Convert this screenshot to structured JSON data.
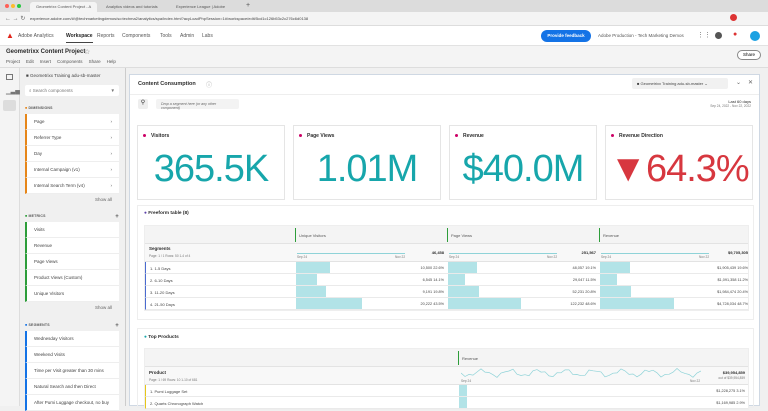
{
  "browser": {
    "tabs": [
      "Geometrixx Content Project - A",
      "Analytics videos and tutorials",
      "Experience League | Adobe"
    ],
    "url": "experience.adobe.com/#/@techmarketingdemos/so:techma2/analytics/spa/index.html?acyLoadPhpSession=1#/workspace/edit/5cd1c126b53c2c276c6d0138"
  },
  "app": {
    "name": "Adobe Analytics",
    "nav": [
      "Workspace",
      "Reports",
      "Components",
      "Tools",
      "Admin",
      "Labs"
    ],
    "feedback": "Provide feedback",
    "org": "Adobe Production - Tech Marketing Demos"
  },
  "project": {
    "title": "Geometrixx Content Project",
    "menu": [
      "Project",
      "Edit",
      "Insert",
      "Components",
      "Share",
      "Help"
    ],
    "share": "Share"
  },
  "panel": {
    "report_suite": "Geometrixx Training adu-sb-master",
    "search_placeholder": "Search components",
    "dimensions": {
      "label": "DIMENSIONS",
      "items": [
        "Page",
        "Referrer Type",
        "Day",
        "Internal Campaign (v1)",
        "Internal Search Term (v4)"
      ],
      "show_all": "Show all",
      "color": "#e68619"
    },
    "metrics": {
      "label": "METRICS",
      "items": [
        "Visits",
        "Revenue",
        "Page Views",
        "Product Views (Custom)",
        "Unique Visitors"
      ],
      "show_all": "Show all",
      "color": "#2d9d3a"
    },
    "segments": {
      "label": "SEGMENTS",
      "items": [
        "Wednesday Visitors",
        "Weekend Visits",
        "Time per Visit greater than 30 mins",
        "Natural Search and then Direct",
        "After Pumi Luggage checkout, no buy"
      ],
      "color": "#1473e6"
    }
  },
  "main": {
    "title": "Content Consumption",
    "report_suite": "Geometrixx Training adu-sb-master",
    "drop_zone": "Drop a segment here (or any other component)",
    "date_label": "Last 60 days",
    "date_range": "Sep 24, 2022 - Nov 22, 2022",
    "cards": [
      {
        "title": "Visitors",
        "value": "365.5K"
      },
      {
        "title": "Page Views",
        "value": "1.01M"
      },
      {
        "title": "Revenue",
        "value": "$40.0M"
      },
      {
        "title": "Revenue Direction",
        "value": "64.3%",
        "direction": "down",
        "color": "#d7373f"
      }
    ],
    "freeform": {
      "title": "Freeform table (8)",
      "dim": "Segments",
      "paging": "Page: 1 / 1  Rows: 50  1-4 of 4",
      "start": "Sep 24",
      "end": "Nov 22",
      "columns": [
        {
          "name": "Unique Visitors",
          "total": "46,458"
        },
        {
          "name": "Page Views",
          "total": "251,567"
        },
        {
          "name": "Revenue",
          "total": "$9,705,305"
        }
      ],
      "rows": [
        {
          "label": "1. 1-5 Days",
          "cells": [
            [
              "10,500",
              "22.6%",
              22.6
            ],
            [
              "48,057",
              "19.1%",
              19.1
            ],
            [
              "$1,905,439",
              "19.6%",
              19.6
            ]
          ]
        },
        {
          "label": "2. 6-10 Days",
          "cells": [
            [
              "6,545",
              "14.1%",
              14.1
            ],
            [
              "29,047",
              "11.5%",
              11.5
            ],
            [
              "$1,091,358",
              "11.2%",
              11.2
            ]
          ]
        },
        {
          "label": "3. 11-20 Days",
          "cells": [
            [
              "9,191",
              "19.8%",
              19.8
            ],
            [
              "52,231",
              "20.8%",
              20.8
            ],
            [
              "$1,984,474",
              "20.4%",
              20.4
            ]
          ]
        },
        {
          "label": "4. 21-50 Days",
          "cells": [
            [
              "20,222",
              "43.5%",
              43.5
            ],
            [
              "122,232",
              "48.6%",
              48.6
            ],
            [
              "$4,728,034",
              "48.7%",
              48.7
            ]
          ]
        }
      ]
    },
    "top_products": {
      "title": "Top Products",
      "dim": "Product",
      "paging": "Page: 1 / 69  Rows: 10  1-10 of 681",
      "column": "Revenue",
      "start": "Sep 24",
      "end": "Nov 22",
      "total": "$39,954,859",
      "total_sub": "out of $39,954,859",
      "rows": [
        {
          "label": "1. Pumi Luggage Set",
          "value": "$1,228,275",
          "pct": "3.1%"
        },
        {
          "label": "2. Quarts Chronograph Watch",
          "value": "$1,169,985",
          "pct": "2.9%"
        }
      ]
    }
  }
}
